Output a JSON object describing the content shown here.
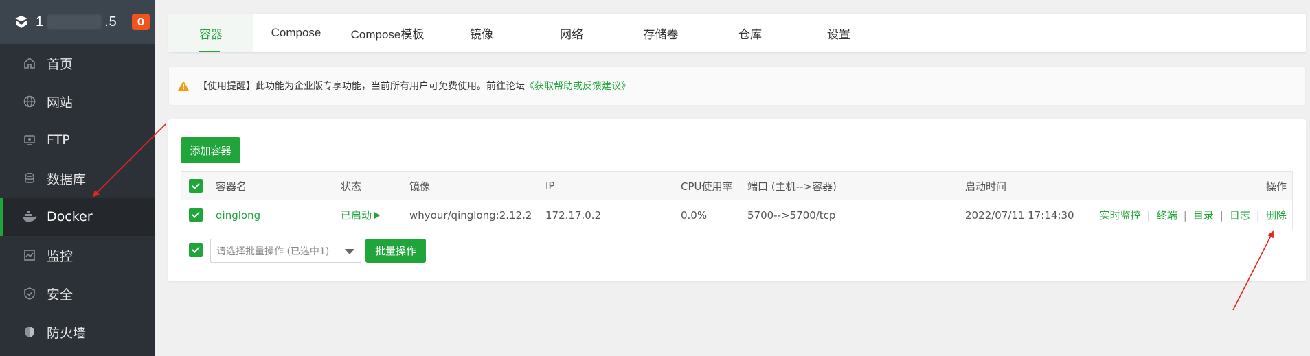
{
  "sidebar": {
    "host_prefix": "1",
    "host_suffix": ".5",
    "badge": "0",
    "items": [
      {
        "label": "首页",
        "icon": "home-icon"
      },
      {
        "label": "网站",
        "icon": "globe-icon"
      },
      {
        "label": "FTP",
        "icon": "ftp-icon"
      },
      {
        "label": "数据库",
        "icon": "database-icon"
      },
      {
        "label": "Docker",
        "icon": "docker-icon",
        "active": true
      },
      {
        "label": "监控",
        "icon": "monitor-icon"
      },
      {
        "label": "安全",
        "icon": "shield-icon"
      },
      {
        "label": "防火墙",
        "icon": "firewall-icon"
      }
    ]
  },
  "tabs": [
    "容器",
    "Compose",
    "Compose模板",
    "镜像",
    "网络",
    "存储卷",
    "仓库",
    "设置"
  ],
  "notice": {
    "text": "【使用提醒】此功能为企业版专享功能，当前所有用户可免费使用。前往论坛",
    "link": "《获取帮助或反馈建议》"
  },
  "add_container_label": "添加容器",
  "table": {
    "headers": {
      "name": "容器名",
      "status": "状态",
      "image": "镜像",
      "ip": "IP",
      "cpu": "CPU使用率",
      "port": "端口 (主机-->容器)",
      "start_time": "启动时间",
      "ops": "操作"
    },
    "rows": [
      {
        "name": "qinglong",
        "status": "已启动",
        "image": "whyour/qinglong:2.12.2",
        "ip": "172.17.0.2",
        "cpu": "0.0%",
        "port": "5700-->5700/tcp",
        "start_time": "2022/07/11 17:14:30",
        "ops": [
          "实时监控",
          "终端",
          "目录",
          "日志",
          "删除"
        ]
      }
    ]
  },
  "batch": {
    "placeholder": "请选择批量操作 (已选中1)",
    "button": "批量操作"
  },
  "colors": {
    "accent": "#20a53a",
    "badge": "#f0541e",
    "sidebar_bg": "#2c3138",
    "arrow": "#e8231c"
  }
}
